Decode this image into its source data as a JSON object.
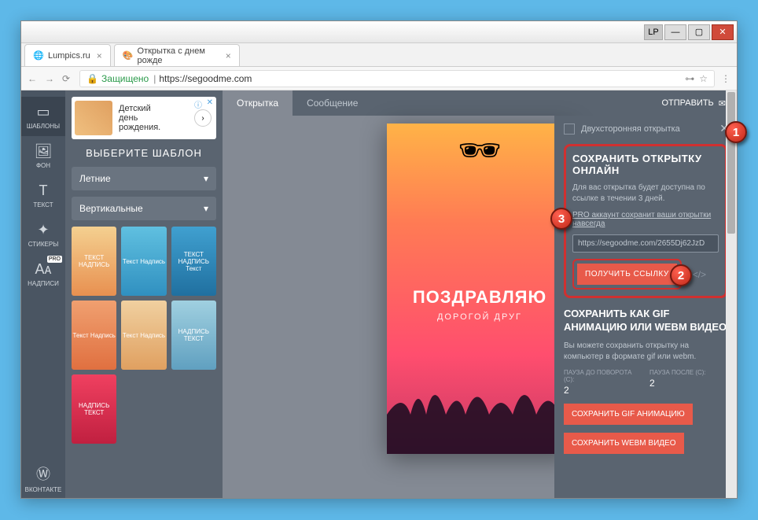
{
  "browser": {
    "lp": "LP",
    "tab1": "Lumpics.ru",
    "tab2": "Открытка с днем рожде",
    "secure": "Защищено",
    "url": "https://segoodme.com"
  },
  "tools": {
    "templates": "ШАБЛОНЫ",
    "background": "ФОН",
    "text": "ТЕКСТ",
    "stickers": "СТИКЕРЫ",
    "labels": "НАДПИСИ",
    "vk": "ВКОНТАКТЕ"
  },
  "ad": {
    "line1": "Детский",
    "line2": "день",
    "line3": "рождения."
  },
  "panel": {
    "title": "ВЫБЕРИТЕ ШАБЛОН",
    "dd1": "Летние",
    "dd2": "Вертикальные"
  },
  "templates_txt": {
    "t1": "ТЕКСТ\nНАДПИСЬ",
    "t2": "Текст\nНадпись",
    "t3": "ТЕКСТ\nНАДПИСЬ\nТекст",
    "t4": "Текст\nНадпись",
    "t5": "Текст\nНадпись",
    "t6": "НАДПИСЬ\nТЕКСТ",
    "t7": "НАДПИСЬ\nТЕКСТ"
  },
  "tabs": {
    "postcard": "Открытка",
    "message": "Сообщение",
    "send": "ОТПРАВИТЬ"
  },
  "card": {
    "title": "ПОЗДРАВЛЯЮ",
    "sub": "ДОРОГОЙ ДРУГ"
  },
  "send_panel": {
    "two_sided": "Двухсторонняя открытка",
    "save_title": "СОХРАНИТЬ ОТКРЫТКУ ОНЛАЙН",
    "save_desc": "Для вас открытка будет доступна по ссылке в течении 3 дней.",
    "pro_link": "PRO аккаунт сохранит ваши открытки навсегда",
    "link_value": "https://segoodme.com/2655Dj62JzD",
    "get_link": "ПОЛУЧИТЬ ССЫЛКУ",
    "embed": "</>",
    "gif_title": "СОХРАНИТЬ КАК GIF АНИМАЦИЮ ИЛИ WEBM ВИДЕО",
    "gif_desc": "Вы можете сохранить открытку на компьютер в формате gif или webm.",
    "pause_before": "ПАУЗА ДО ПОВОРОТА (С):",
    "pause_after": "ПАУЗА ПОСЛЕ (С):",
    "pause_val1": "2",
    "pause_val2": "2",
    "save_gif": "СОХРАНИТЬ GIF АНИМАЦИЮ",
    "save_webm": "СОХРАНИТЬ WEBM ВИДЕО"
  },
  "markers": {
    "m1": "1",
    "m2": "2",
    "m3": "3"
  }
}
